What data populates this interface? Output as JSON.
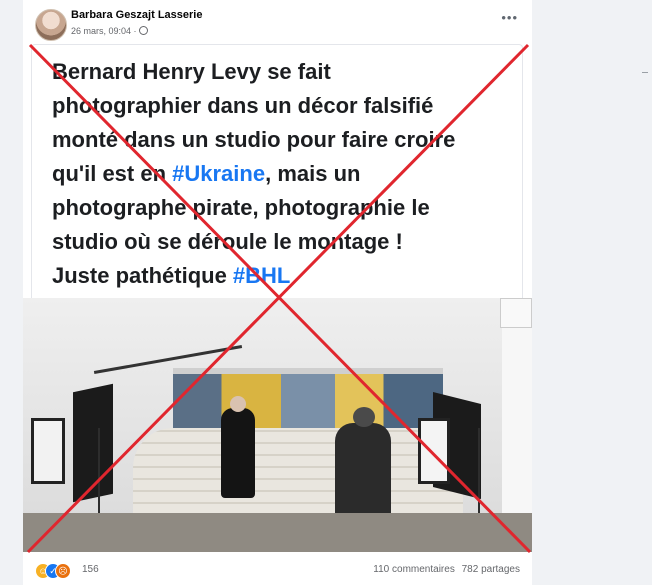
{
  "post": {
    "author": "Barbara Geszajt Lasserie",
    "date": "26 mars, 09:04 ·",
    "more_icon": "more-horizontal-icon",
    "text_lines": [
      "Bernard Henry Levy se fait",
      "photographier dans un décor falsifié",
      "monté dans un studio pour faire croire",
      "qu'il est en ",
      "#Ukraine",
      ", mais un",
      "photographe pirate, photographie le",
      "studio où se déroule le montage !",
      "Juste pathétique ",
      "#BHL"
    ],
    "reactions_count": "156",
    "comments": "110 commentaires",
    "shares": "782 partages"
  },
  "colors": {
    "x_mark": "#e0262e",
    "hashtag": "#1877f2"
  }
}
